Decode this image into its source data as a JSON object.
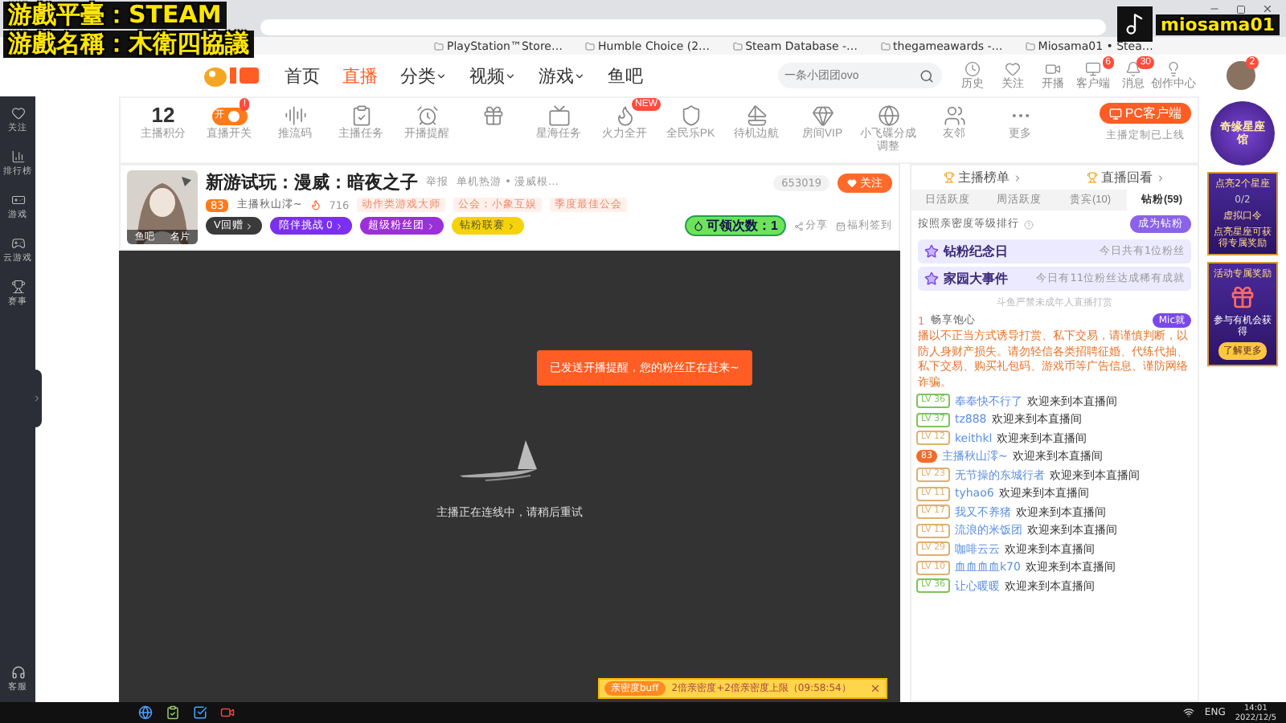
{
  "overlay": {
    "lines": [
      "游戲平臺：STEAM",
      "游戲名稱：木衛四協議"
    ],
    "account": "miosama01"
  },
  "bookmarks": [
    "PlayStation™Store…",
    "Humble Choice (2…",
    "Steam Database -…",
    "thegameawards -…",
    "Miosama01 • Stea…"
  ],
  "header": {
    "nav": [
      {
        "label": "首页",
        "selected": false,
        "dropdown": false
      },
      {
        "label": "直播",
        "selected": true,
        "dropdown": false
      },
      {
        "label": "分类",
        "selected": false,
        "dropdown": true
      },
      {
        "label": "视频",
        "selected": false,
        "dropdown": true
      },
      {
        "label": "游戏",
        "selected": false,
        "dropdown": true
      },
      {
        "label": "鱼吧",
        "selected": false,
        "dropdown": false
      }
    ],
    "search": {
      "placeholder": "一条小团团ovo"
    },
    "actions": [
      {
        "label": "历史"
      },
      {
        "label": "关注"
      },
      {
        "label": "开播"
      },
      {
        "label": "客户端",
        "badge": "6"
      },
      {
        "label": "消息",
        "badge": "30"
      },
      {
        "label": "创作中心"
      }
    ],
    "avatar_badge": "2"
  },
  "sidebar": {
    "items": [
      "关注",
      "排行榜",
      "游戏",
      "云游戏",
      "赛事"
    ],
    "bottom": "客服"
  },
  "toolbar": {
    "items": [
      {
        "kind": "score",
        "value": "12",
        "label": "主播积分"
      },
      {
        "kind": "toggle",
        "on": true,
        "toggle_text": "开",
        "badge": "!",
        "label": "直播开关"
      },
      {
        "kind": "icon",
        "label": "推流码"
      },
      {
        "kind": "icon",
        "label": "主播任务"
      },
      {
        "kind": "icon",
        "label": "开播提醒"
      },
      {
        "kind": "icon"
      },
      {
        "kind": "icon",
        "label": "星海任务"
      },
      {
        "kind": "icon",
        "label": "火力全开",
        "badge": "NEW"
      },
      {
        "kind": "icon",
        "label": "全民乐PK"
      },
      {
        "kind": "icon",
        "label": "待机边航"
      },
      {
        "kind": "icon",
        "label": "房间VIP"
      },
      {
        "kind": "icon",
        "label": "小飞碟分成调整"
      },
      {
        "kind": "icon",
        "label": "友邻"
      },
      {
        "kind": "icon",
        "label": "更多"
      }
    ],
    "pc_client": {
      "label": "PC客户端",
      "note": "主播定制已上线"
    }
  },
  "room": {
    "avatar_links": [
      "鱼吧",
      "名片"
    ],
    "title": "新游试玩：漫威：暗夜之子",
    "report": "举报",
    "category": "单机热游 • 漫威根…",
    "level": "83",
    "host": "主播秋山澪~",
    "heat": "716",
    "honor": "动作类游戏大师",
    "guild": "公会：小象互娱",
    "guild_award": "季度最佳公会",
    "pills": [
      {
        "label": "V回赠",
        "color": "#3a3a3a"
      },
      {
        "label": "陪伴挑战 0",
        "color": "#7b2ff0"
      },
      {
        "label": "超级粉丝团",
        "color": "#9b30d9"
      },
      {
        "label": "钻粉联赛",
        "color": "#f5d20a"
      }
    ],
    "followers": "653019",
    "follow": "关注",
    "claims": "可领次数：",
    "claims_count": "1",
    "share": "分享",
    "checkin": "福利签到"
  },
  "player": {
    "toast": "已发送开播提醒，您的粉丝正在赶来~",
    "status": "主播正在连线中，请稍后重试",
    "buff": {
      "tag": "亲密度buff",
      "text": "2倍亲密度+2倍亲密度上限（09:58:54）"
    }
  },
  "side_panel": {
    "links": [
      "主播榜单",
      "直播回看"
    ],
    "tabs": [
      {
        "label": "日活跃度",
        "selected": false
      },
      {
        "label": "周活跃度",
        "selected": false
      },
      {
        "label": "贵宾(10)",
        "selected": false
      },
      {
        "label": "钻粉(59)",
        "selected": true
      }
    ],
    "rank_note": "按照亲密度等级排行",
    "become": "成为钻粉",
    "cards": [
      {
        "title": "钻粉纪念日",
        "text": "今日共有1位粉丝"
      },
      {
        "title": "家园大事件",
        "text": "今日有11位粉丝达成稀有成就"
      }
    ],
    "minor_note": "斗鱼严禁未成年人直播打赏",
    "top_fan": {
      "rank": "1",
      "name": "畅享饱心",
      "badge": "Mic就"
    },
    "notice": "播以不正当方式诱导打赏、私下交易，请谨慎判断，以防人身财产损失。请勿轻信各类招聘征婚、代练代抽、私下交易、购买礼包码、游戏币等广告信息、谨防网络诈骗。",
    "chat": [
      {
        "kind": "level",
        "level": "LV 36",
        "color": "#7cc45a",
        "name": "奉奉快不行了",
        "message": "欢迎来到本直播间"
      },
      {
        "kind": "level",
        "level": "LV 37",
        "color": "#7cc45a",
        "name": "tz888",
        "message": "欢迎来到本直播间"
      },
      {
        "kind": "level",
        "level": "LV 12",
        "color": "#e0b070",
        "name": "keithkl",
        "message": "欢迎来到本直播间"
      },
      {
        "kind": "fan",
        "level": "83",
        "color": "#f26b2a",
        "name": "主播秋山澪~",
        "message": "欢迎来到本直播间"
      },
      {
        "kind": "level",
        "level": "LV 23",
        "color": "#e0b070",
        "name": "无节操的东城行者",
        "message": "欢迎来到本直播间"
      },
      {
        "kind": "level",
        "level": "LV 11",
        "color": "#e0b070",
        "name": "tyhao6",
        "message": "欢迎来到本直播间"
      },
      {
        "kind": "level",
        "level": "LV 17",
        "color": "#e0b070",
        "name": "我又不养猪",
        "message": "欢迎来到本直播间"
      },
      {
        "kind": "level",
        "level": "LV 11",
        "color": "#e0b070",
        "name": "流浪的米饭团",
        "message": "欢迎来到本直播间"
      },
      {
        "kind": "level",
        "level": "LV 29",
        "color": "#e0b070",
        "name": "咖啡云云",
        "message": "欢迎来到本直播间"
      },
      {
        "kind": "level",
        "level": "LV 10",
        "color": "#e0b070",
        "name": "血血血血k70",
        "message": "欢迎来到本直播间"
      },
      {
        "kind": "level",
        "level": "LV 36",
        "color": "#7cc45a",
        "name": "让心暖暖",
        "message": "欢迎来到本直播间"
      }
    ]
  },
  "promo": {
    "badge": "奇缘星座馆",
    "task": "点亮2个星座",
    "progress": "0/2",
    "code": "虚拟口令",
    "reward_note": "点亮星座可获得专属奖励",
    "event": "活动专属奖励",
    "join": "参与有机会获得",
    "more": "了解更多"
  },
  "taskbar": {
    "lang": "ENG",
    "time": "14:01",
    "date": "2022/12/5"
  }
}
